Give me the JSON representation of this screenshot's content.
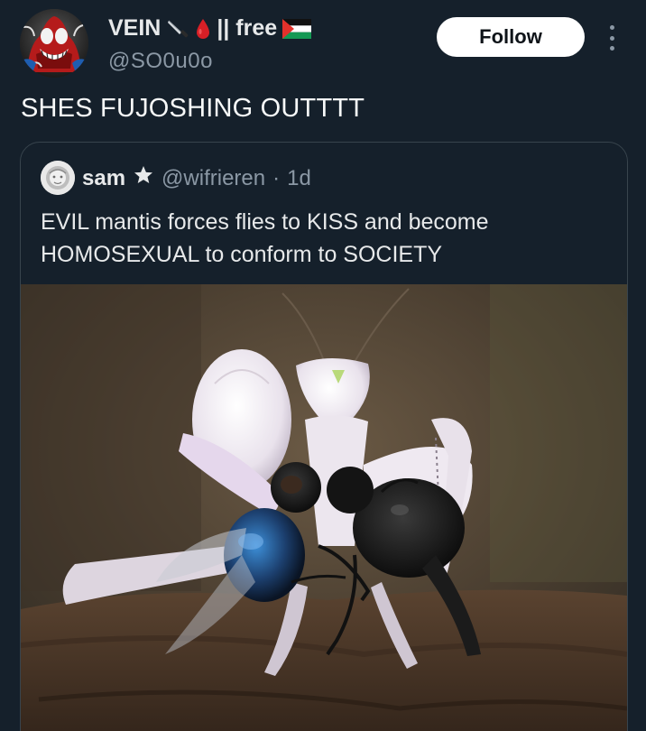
{
  "author": {
    "display_name": "VEIN",
    "name_suffix": "|| free",
    "handle": "@SO0u0o",
    "avatar_icon": "carnage-avatar-icon",
    "name_icons": [
      "knife-icon",
      "blood-drop-icon",
      "palestine-flag-icon"
    ]
  },
  "actions": {
    "follow_label": "Follow",
    "more_icon": "more-vertical-icon"
  },
  "tweet": {
    "text": "SHES FUJOSHING OUTTTT"
  },
  "quote": {
    "name": "sam",
    "handle": "@wifrieren",
    "separator": "·",
    "time": "1d",
    "star_icon": "star-icon",
    "text": "EVIL mantis forces flies to KISS and become HOMOSEXUAL to conform to SOCIETY",
    "media": {
      "description_icon": "mantis-with-flies-photo"
    }
  },
  "colors": {
    "background": "#15202b",
    "text_primary": "#e7e9ea",
    "text_secondary": "#8b98a5",
    "border": "#38444d",
    "follow_bg": "#ffffff",
    "follow_text": "#0f1419"
  }
}
